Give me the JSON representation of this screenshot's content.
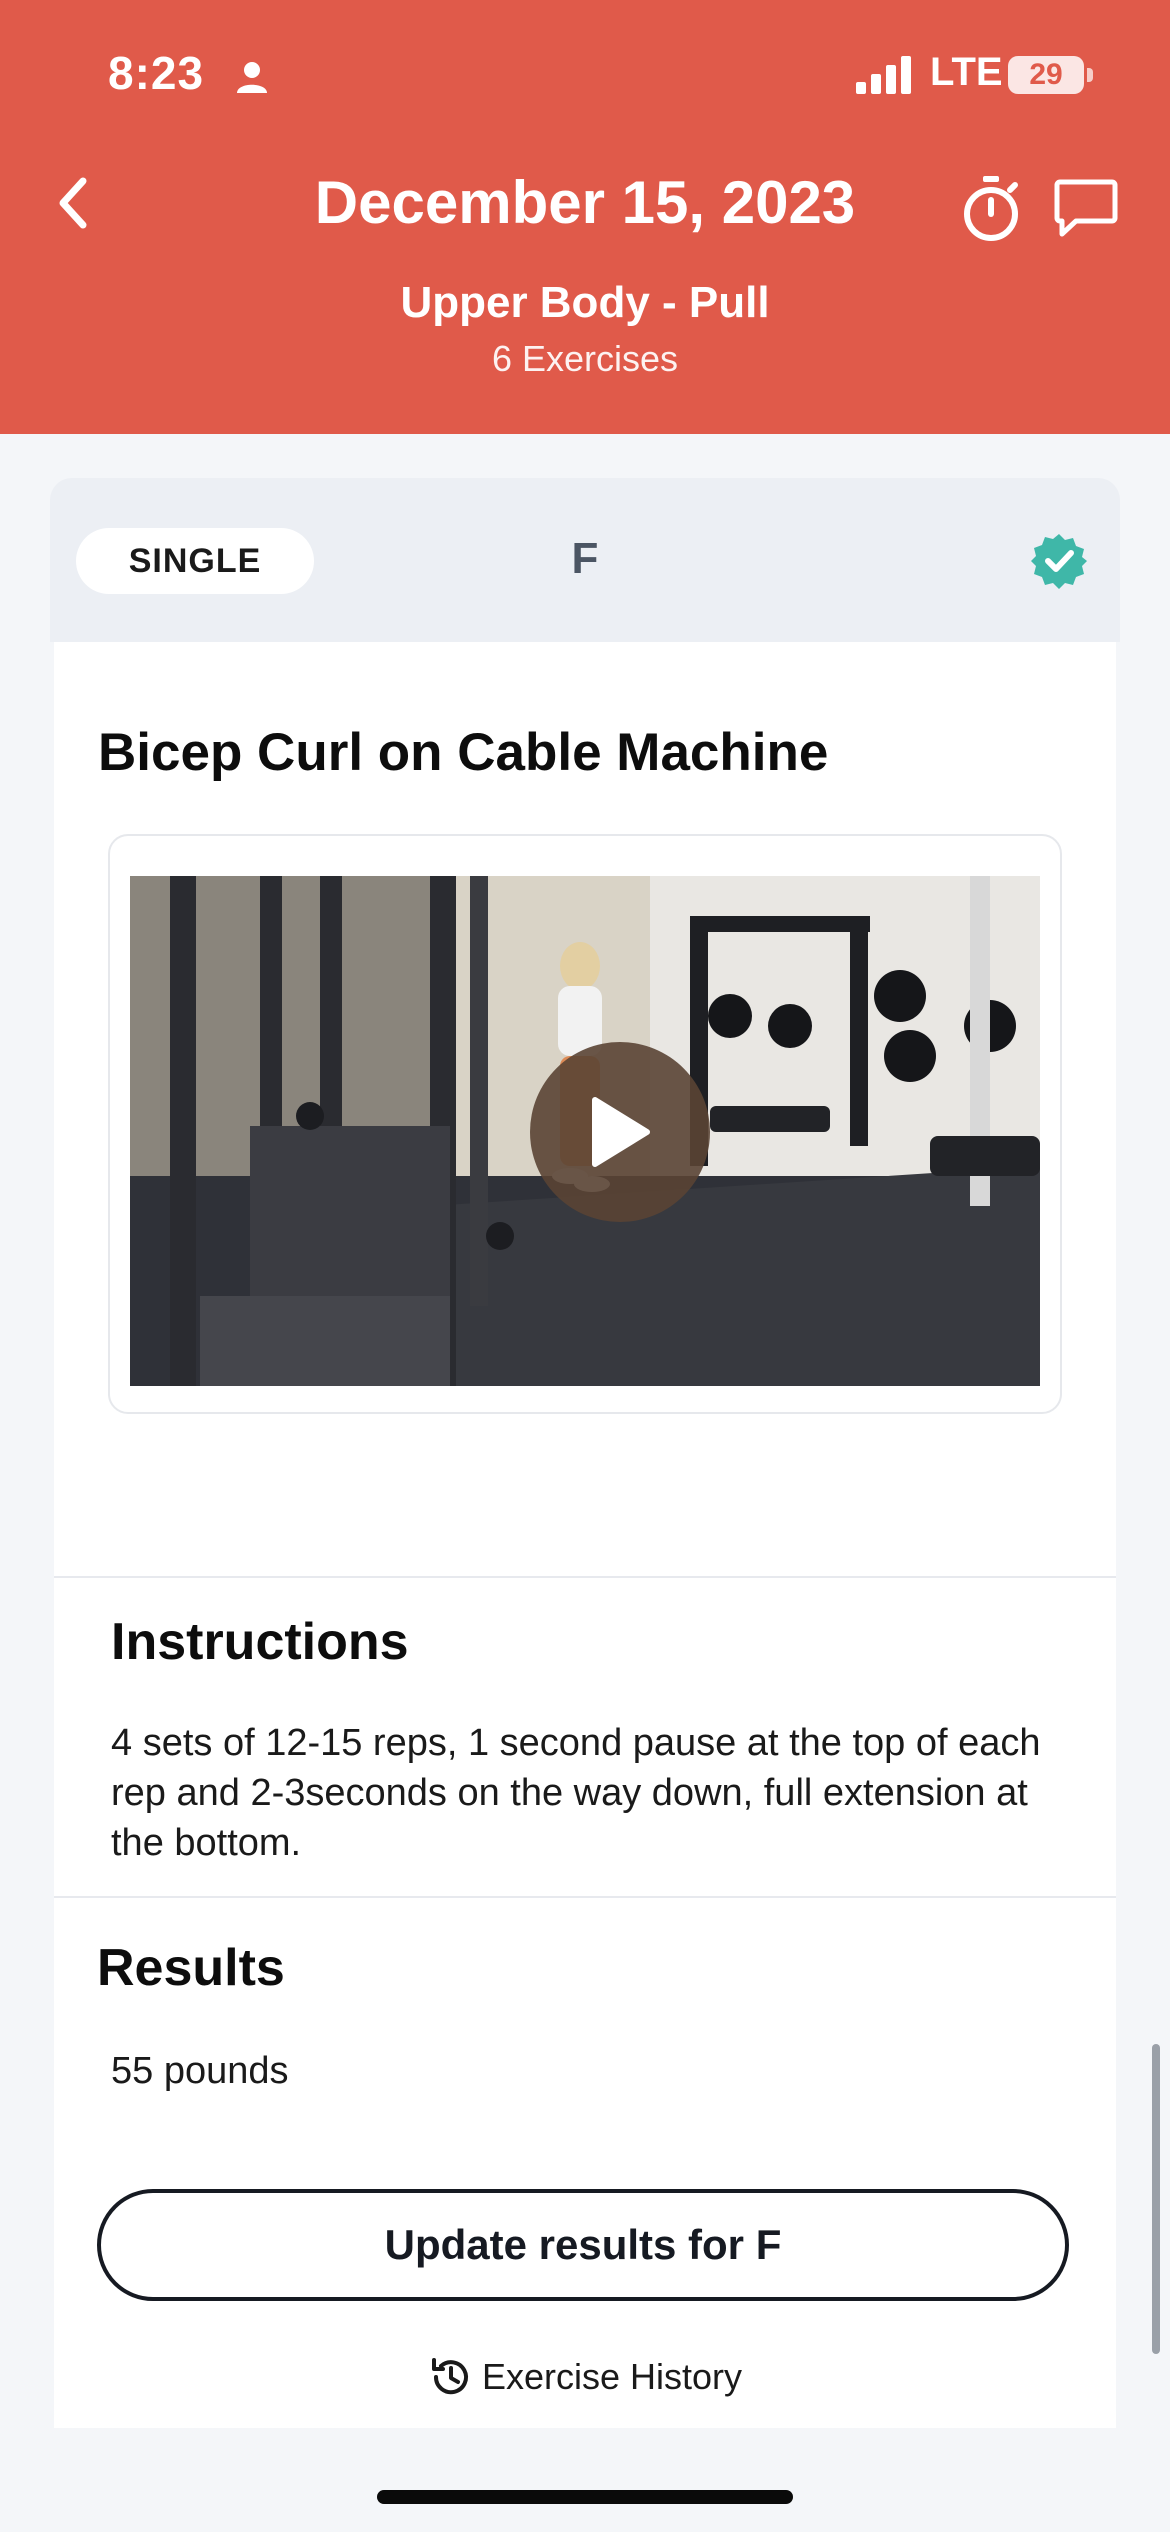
{
  "status_bar": {
    "time": "8:23",
    "network": "LTE",
    "battery": "29"
  },
  "header": {
    "date": "December 15, 2023",
    "workout_name": "Upper Body - Pull",
    "exercise_count": "6 Exercises",
    "background_color": "#e05a4a"
  },
  "card": {
    "type_badge": "SINGLE",
    "set_letter": "F",
    "completed_color": "#3fb7a8",
    "exercise_title": "Bicep Curl on Cable Machine"
  },
  "instructions": {
    "title": "Instructions",
    "text": "4 sets of 12-15 reps, 1 second pause at the top of each rep and 2-3seconds on the way down, full extension at the bottom."
  },
  "results": {
    "title": "Results",
    "value": "55 pounds",
    "update_button": "Update results for F",
    "history_link": "Exercise History"
  }
}
